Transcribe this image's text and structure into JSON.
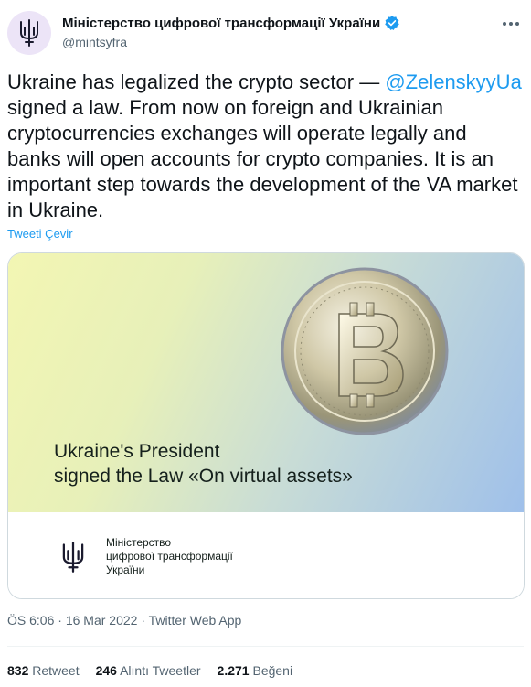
{
  "author": {
    "display_name": "Міністерство цифрової трансформації України",
    "handle": "@mintsyfra",
    "avatar_icon": "trident-icon",
    "verified_icon": "verified-badge-icon"
  },
  "tweet": {
    "text_before_mention": "Ukraine has legalized the crypto sector — ",
    "mention": "@ZelenskyyUa",
    "text_after_mention": " signed a law. From now on foreign and Ukrainian cryptocurrencies exchanges will operate legally and banks will open accounts for crypto companies. It is an important step towards the development of the VA market in Ukraine.",
    "translate_label": "Tweeti Çevir"
  },
  "media": {
    "headline_line1": "Ukraine's President",
    "headline_line2": "signed the Law «On virtual assets»",
    "coin_icon": "bitcoin-coin-icon",
    "ministry_line1": "Міністерство",
    "ministry_line2": "цифрової трансформації",
    "ministry_line3": "України"
  },
  "meta": {
    "time": "ÖS 6:06",
    "date": "16 Mar 2022",
    "source": "Twitter Web App",
    "separator": "·"
  },
  "stats": {
    "retweets_count": "832",
    "retweets_label": "Retweet",
    "quotes_count": "246",
    "quotes_label": "Alıntı Tweetler",
    "likes_count": "2.271",
    "likes_label": "Beğeni"
  },
  "colors": {
    "accent": "#1d9bf0",
    "avatar_bg": "#ece4f7",
    "muted_text": "#536471"
  }
}
